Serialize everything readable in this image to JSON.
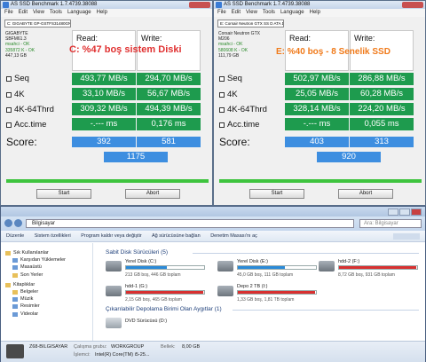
{
  "colors": {
    "accent": "#3d8ee0",
    "green": "#1e9b4e",
    "red": "#e03030",
    "orange": "#f07a1a"
  },
  "windows": [
    {
      "title": "AS SSD Benchmark 1.7.4739.38088",
      "menu": [
        "File",
        "Edit",
        "View",
        "Tools",
        "Language",
        "Help"
      ],
      "drive_select": "C: GIGABYTE GP-GSTFS31480GNTD ATA D",
      "info": [
        "GIGABYTE",
        "SBFM61.3",
        "msahci - OK",
        "335872 K - OK",
        "447,13 GB"
      ],
      "read_label": "Read:",
      "write_label": "Write:",
      "rows": [
        "Seq",
        "4K",
        "4K-64Thrd",
        "Acc.time"
      ],
      "read": [
        "493,77 MB/s",
        "33,10 MB/s",
        "309,32 MB/s",
        "-.--- ms"
      ],
      "write": [
        "294,70 MB/s",
        "56,67 MB/s",
        "494,39 MB/s",
        "0,176 ms"
      ],
      "score_label": "Score:",
      "score_read": "392",
      "score_write": "581",
      "score_total": "1175",
      "start": "Start",
      "abort": "Abort",
      "overlay": "C: %47 boş sistem Diski"
    },
    {
      "title": "AS SSD Benchmark 1.7.4739.38088",
      "menu": [
        "File",
        "Edit",
        "View",
        "Tools",
        "Language",
        "Help"
      ],
      "drive_select": "E: Corsair Neutron GTX SS D ATA Device",
      "info": [
        "Corsair Neutron GTX",
        "M206",
        "msahci - OK",
        "580608 K - OK",
        "111,79 GB"
      ],
      "read_label": "Read:",
      "write_label": "Write:",
      "rows": [
        "Seq",
        "4K",
        "4K-64Thrd",
        "Acc.time"
      ],
      "read": [
        "502,97 MB/s",
        "25,05 MB/s",
        "328,14 MB/s",
        "-.--- ms"
      ],
      "write": [
        "286,88 MB/s",
        "60,28 MB/s",
        "224,20 MB/s",
        "0,055 ms"
      ],
      "score_label": "Score:",
      "score_read": "403",
      "score_write": "313",
      "score_total": "920",
      "start": "Start",
      "abort": "Abort",
      "overlay": "E: %40 boş - 8 Senelik SSD"
    }
  ],
  "explorer": {
    "path": "Bilgisayar",
    "search": "Ara: Bilgisayar",
    "toolbar": [
      "Düzenle",
      "Sistem özellikleri",
      "Program kaldır veya değiştir",
      "Ağ sürücüsüne bağlan",
      "Denetim Masası'nı aç"
    ],
    "sidebar": [
      {
        "label": "Sık Kullanılanlar",
        "top": true
      },
      {
        "label": "Karşıdan Yüklemeler"
      },
      {
        "label": "Masaüstü"
      },
      {
        "label": "Son Yerler"
      },
      {
        "label": "Kitaplıklar",
        "top": true
      },
      {
        "label": "Belgeler"
      },
      {
        "label": "Müzik"
      },
      {
        "label": "Resimler"
      },
      {
        "label": "Videolar"
      }
    ],
    "group_hdd": "Sabit Disk Sürücüleri (5)",
    "group_removable": "Çıkarılabilir Depolama Birimi Olan Aygıtlar (1)",
    "drives": [
      {
        "name": "Yerel Disk (C:)",
        "free": "213 GB boş, 446 GB toplam",
        "used": 0.52,
        "color": "#2a8ad8"
      },
      {
        "name": "Yerel Disk (E:)",
        "free": "45,0 GB boş, 111 GB toplam",
        "used": 0.6,
        "color": "#2a8ad8"
      },
      {
        "name": "hdd-2 (F:)",
        "free": "8,72 GB boş, 931 GB toplam",
        "used": 0.99,
        "color": "#d83030"
      },
      {
        "name": "hdd-1 (G:)",
        "free": "2,15 GB boş, 465 GB toplam",
        "used": 0.99,
        "color": "#d83030"
      },
      {
        "name": "Depo 2 TB (I:)",
        "free": "1,33 GB boş, 1,81 TB toplam",
        "used": 0.99,
        "color": "#d83030"
      }
    ],
    "dvd": "DVD Sürücüsü (D:)",
    "status": {
      "name": "Z68-BILGISAYAR",
      "wg_label": "Çalışma grubu:",
      "wg": "WORKGROUP",
      "mem_label": "Bellek:",
      "mem": "8,00 GB",
      "cpu_label": "İşlemci:",
      "cpu": "Intel(R) Core(TM) i5-25..."
    }
  }
}
